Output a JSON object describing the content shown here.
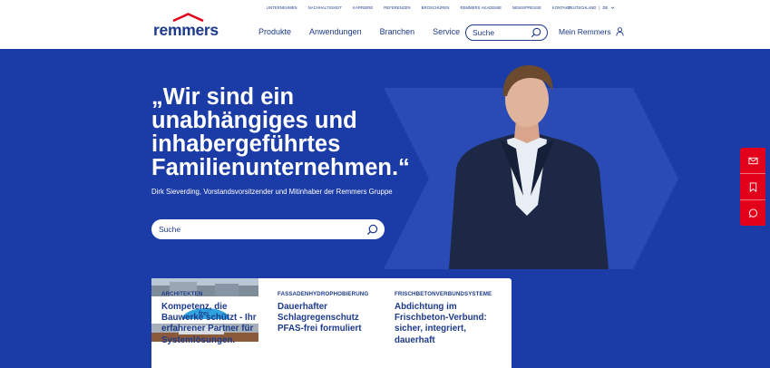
{
  "header": {
    "top_links": [
      "UNTERNEHMEN",
      "NACHHALTIGKEIT",
      "KARRIERE",
      "REFERENZEN",
      "BROSCHÜREN",
      "REMMERS AKADEMIE",
      "NEWS/PRESSE",
      "KONTAKT"
    ],
    "country": "DEUTSCHLAND",
    "separator": "|",
    "language": "DE",
    "logo_text": "remmers",
    "main_nav": [
      "Produkte",
      "Anwendungen",
      "Branchen",
      "Service"
    ],
    "search_placeholder": "Suche",
    "account_label": "Mein Remmers"
  },
  "hero": {
    "headline": "„Wir sind ein unabhängiges und inhabergeführtes Familienunternehmen.“",
    "subline": "Dirk Sieverding, Vorstandsvorsitzender und Mitinhaber der Remmers Gruppe",
    "search_placeholder": "Suche"
  },
  "side_buttons": [
    "mail-icon",
    "bookmark-icon",
    "chat-icon"
  ],
  "cards": [
    {
      "tag": "ARCHITEKTEN",
      "title": "Kompetenz, die Bauwerke schützt - Ihr erfahrener Partner für Systemlösungen."
    },
    {
      "tag": "FASSADENHYDROPHOBIERUNG",
      "title": "Dauerhafter Schlagregenschutz PFAS-frei formuliert"
    },
    {
      "tag": "FRISCHBETONVERBUNDSYSTEME",
      "title": "Abdichtung im Frischbeton-Verbund: sicher, integriert, dauerhaft"
    }
  ],
  "colors": {
    "brand_blue": "#1b3ba6",
    "text_blue": "#1d3a8a",
    "accent_red": "#e2001a"
  }
}
